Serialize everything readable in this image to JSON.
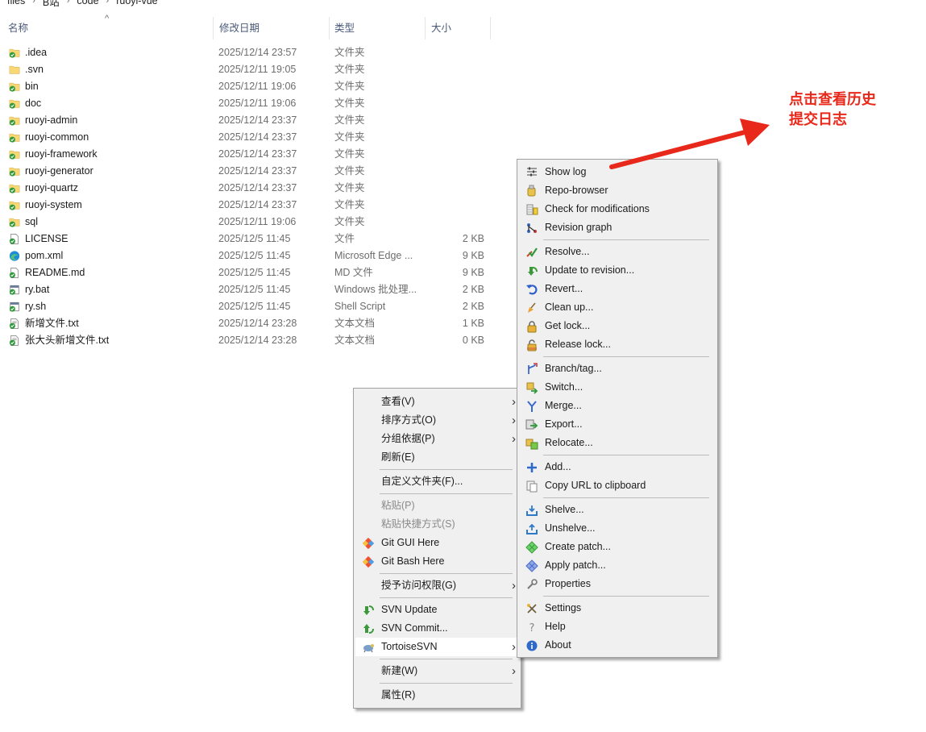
{
  "breadcrumb": [
    "files",
    "B站",
    "code",
    "ruoyi-vue"
  ],
  "columns": {
    "name": "名称",
    "date": "修改日期",
    "type": "类型",
    "size": "大小"
  },
  "files": [
    {
      "name": ".idea",
      "date": "2025/12/14 23:57",
      "type": "文件夹",
      "size": "",
      "icon": "svn-folder-icon"
    },
    {
      "name": ".svn",
      "date": "2025/12/11 19:05",
      "type": "文件夹",
      "size": "",
      "icon": "folder-icon"
    },
    {
      "name": "bin",
      "date": "2025/12/11 19:06",
      "type": "文件夹",
      "size": "",
      "icon": "svn-folder-icon"
    },
    {
      "name": "doc",
      "date": "2025/12/11 19:06",
      "type": "文件夹",
      "size": "",
      "icon": "svn-folder-icon"
    },
    {
      "name": "ruoyi-admin",
      "date": "2025/12/14 23:37",
      "type": "文件夹",
      "size": "",
      "icon": "svn-folder-icon"
    },
    {
      "name": "ruoyi-common",
      "date": "2025/12/14 23:37",
      "type": "文件夹",
      "size": "",
      "icon": "svn-folder-icon"
    },
    {
      "name": "ruoyi-framework",
      "date": "2025/12/14 23:37",
      "type": "文件夹",
      "size": "",
      "icon": "svn-folder-icon"
    },
    {
      "name": "ruoyi-generator",
      "date": "2025/12/14 23:37",
      "type": "文件夹",
      "size": "",
      "icon": "svn-folder-icon"
    },
    {
      "name": "ruoyi-quartz",
      "date": "2025/12/14 23:37",
      "type": "文件夹",
      "size": "",
      "icon": "svn-folder-icon"
    },
    {
      "name": "ruoyi-system",
      "date": "2025/12/14 23:37",
      "type": "文件夹",
      "size": "",
      "icon": "svn-folder-icon"
    },
    {
      "name": "sql",
      "date": "2025/12/11 19:06",
      "type": "文件夹",
      "size": "",
      "icon": "svn-folder-icon"
    },
    {
      "name": "LICENSE",
      "date": "2025/12/5 11:45",
      "type": "文件",
      "size": "2 KB",
      "icon": "svn-file-icon"
    },
    {
      "name": "pom.xml",
      "date": "2025/12/5 11:45",
      "type": "Microsoft Edge ...",
      "size": "9 KB",
      "icon": "edge-icon"
    },
    {
      "name": "README.md",
      "date": "2025/12/5 11:45",
      "type": "MD 文件",
      "size": "9 KB",
      "icon": "svn-file-icon"
    },
    {
      "name": "ry.bat",
      "date": "2025/12/5 11:45",
      "type": "Windows 批处理...",
      "size": "2 KB",
      "icon": "svn-script-icon"
    },
    {
      "name": "ry.sh",
      "date": "2025/12/5 11:45",
      "type": "Shell Script",
      "size": "2 KB",
      "icon": "svn-script-icon"
    },
    {
      "name": "新增文件.txt",
      "date": "2025/12/14 23:28",
      "type": "文本文档",
      "size": "1 KB",
      "icon": "svn-text-icon"
    },
    {
      "name": "张大头新增文件.txt",
      "date": "2025/12/14 23:28",
      "type": "文本文档",
      "size": "0 KB",
      "icon": "svn-text-icon"
    }
  ],
  "explorer_menu": [
    {
      "label": "查看(V)",
      "submenu": true
    },
    {
      "label": "排序方式(O)",
      "submenu": true
    },
    {
      "label": "分组依据(P)",
      "submenu": true
    },
    {
      "label": "刷新(E)"
    },
    {
      "separator": true
    },
    {
      "label": "自定义文件夹(F)..."
    },
    {
      "separator": true
    },
    {
      "label": "粘贴(P)",
      "disabled": true
    },
    {
      "label": "粘贴快捷方式(S)",
      "disabled": true
    },
    {
      "label": "Git GUI Here",
      "icon": "git-icon"
    },
    {
      "label": "Git Bash Here",
      "icon": "git-icon"
    },
    {
      "separator": true
    },
    {
      "label": "授予访问权限(G)",
      "submenu": true
    },
    {
      "separator": true
    },
    {
      "label": "SVN Update",
      "icon": "svn-update-icon"
    },
    {
      "label": "SVN Commit...",
      "icon": "svn-commit-icon"
    },
    {
      "label": "TortoiseSVN",
      "icon": "tortoisesvn-icon",
      "submenu": true,
      "highlighted": true
    },
    {
      "separator": true
    },
    {
      "label": "新建(W)",
      "submenu": true
    },
    {
      "separator": true
    },
    {
      "label": "属性(R)"
    }
  ],
  "svn_menu": [
    {
      "label": "Show log",
      "icon": "show-log-icon"
    },
    {
      "label": "Repo-browser",
      "icon": "repo-browser-icon"
    },
    {
      "label": "Check for modifications",
      "icon": "check-modifications-icon"
    },
    {
      "label": "Revision graph",
      "icon": "revision-graph-icon"
    },
    {
      "separator": true
    },
    {
      "label": "Resolve...",
      "icon": "resolve-icon"
    },
    {
      "label": "Update to revision...",
      "icon": "update-revision-icon"
    },
    {
      "label": "Revert...",
      "icon": "revert-icon"
    },
    {
      "label": "Clean up...",
      "icon": "cleanup-icon"
    },
    {
      "label": "Get lock...",
      "icon": "get-lock-icon"
    },
    {
      "label": "Release lock...",
      "icon": "release-lock-icon"
    },
    {
      "separator": true
    },
    {
      "label": "Branch/tag...",
      "icon": "branch-icon"
    },
    {
      "label": "Switch...",
      "icon": "switch-icon"
    },
    {
      "label": "Merge...",
      "icon": "merge-icon"
    },
    {
      "label": "Export...",
      "icon": "export-icon"
    },
    {
      "label": "Relocate...",
      "icon": "relocate-icon"
    },
    {
      "separator": true
    },
    {
      "label": "Add...",
      "icon": "add-icon"
    },
    {
      "label": "Copy URL to clipboard",
      "icon": "copy-url-icon"
    },
    {
      "separator": true
    },
    {
      "label": "Shelve...",
      "icon": "shelve-icon"
    },
    {
      "label": "Unshelve...",
      "icon": "unshelve-icon"
    },
    {
      "label": "Create patch...",
      "icon": "create-patch-icon"
    },
    {
      "label": "Apply patch...",
      "icon": "apply-patch-icon"
    },
    {
      "label": "Properties",
      "icon": "properties-icon"
    },
    {
      "separator": true
    },
    {
      "label": "Settings",
      "icon": "settings-icon"
    },
    {
      "label": "Help",
      "icon": "help-icon"
    },
    {
      "label": "About",
      "icon": "about-icon"
    }
  ],
  "annotation": {
    "line1": "点击查看历史",
    "line2": "提交日志",
    "color": "#e8281a"
  }
}
